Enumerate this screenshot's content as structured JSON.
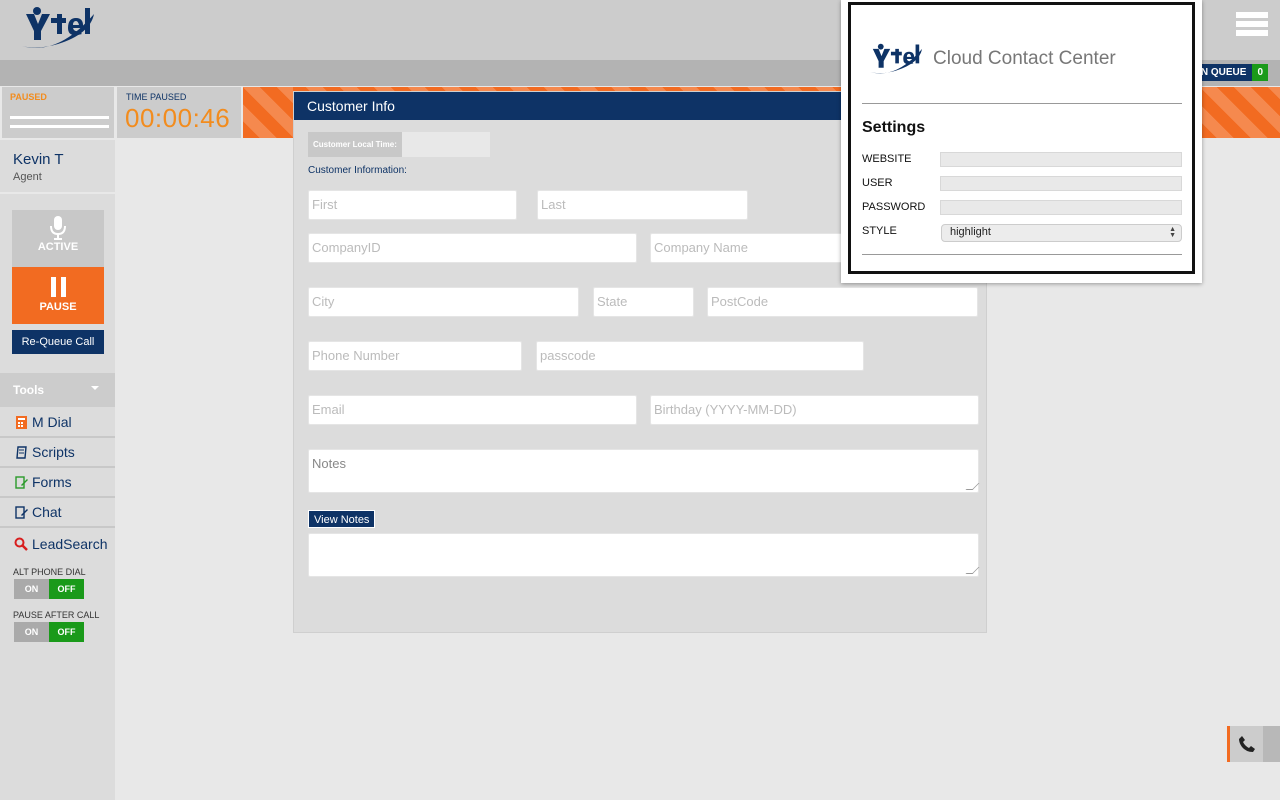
{
  "app": {
    "brand": "Ytel",
    "menu_icon": "hamburger-icon"
  },
  "queue": {
    "label": "S IN QUEUE",
    "count": "0"
  },
  "status": {
    "state_label": "PAUSED",
    "time_label": "TIME PAUSED",
    "time_value": "00:00:46"
  },
  "agent": {
    "name": "Kevin T",
    "role": "Agent"
  },
  "controls": {
    "active_label": "ACTIVE",
    "pause_label": "PAUSE",
    "requeue_label": "Re-Queue Call"
  },
  "tools": {
    "header": "Tools",
    "items": [
      {
        "label": "M Dial",
        "icon": "calculator-icon",
        "color": "#f26b21"
      },
      {
        "label": "Scripts",
        "icon": "scroll-icon",
        "color": "#0e3366"
      },
      {
        "label": "Forms",
        "icon": "edit-form-icon",
        "color": "#2a9a2a"
      },
      {
        "label": "Chat",
        "icon": "chat-edit-icon",
        "color": "#0e3366"
      },
      {
        "label": "LeadSearch",
        "icon": "search-icon",
        "color": "#d81e1e"
      }
    ]
  },
  "toggles": [
    {
      "label": "ALT PHONE DIAL",
      "on": "ON",
      "off": "OFF",
      "state": "off"
    },
    {
      "label": "PAUSE AFTER CALL",
      "on": "ON",
      "off": "OFF",
      "state": "off"
    }
  ],
  "customer": {
    "title": "Customer Info",
    "local_time_label": "Customer Local Time:",
    "local_time_value": "",
    "section_label": "Customer Information:",
    "fields": {
      "first": "First",
      "last": "Last",
      "company_id": "CompanyID",
      "company_name": "Company Name",
      "city": "City",
      "state": "State",
      "postcode": "PostCode",
      "phone": "Phone Number",
      "passcode": "passcode",
      "email": "Email",
      "birthday": "Birthday (YYYY-MM-DD)",
      "notes": "Notes"
    },
    "view_notes_label": "View Notes"
  },
  "settings_popup": {
    "brand_text": "Cloud Contact Center",
    "title": "Settings",
    "website_label": "WEBSITE",
    "website_value": "",
    "user_label": "USER",
    "user_value": "",
    "password_label": "PASSWORD",
    "password_value": "",
    "style_label": "STYLE",
    "style_value": "highlight"
  },
  "colors": {
    "navy": "#0e3366",
    "orange": "#f26b21",
    "green": "#1a9a1a"
  }
}
